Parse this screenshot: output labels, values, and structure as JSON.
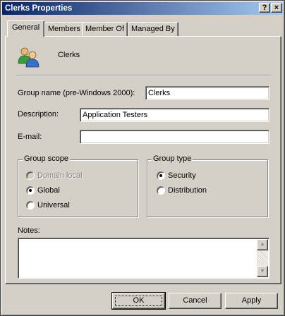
{
  "window": {
    "title": "Clerks Properties",
    "help_button": "?",
    "close_button": "×"
  },
  "tabs": [
    {
      "label": "General",
      "active": true
    },
    {
      "label": "Members",
      "active": false
    },
    {
      "label": "Member Of",
      "active": false
    },
    {
      "label": "Managed By",
      "active": false
    }
  ],
  "header": {
    "icon": "users-group-icon",
    "group_name": "Clerks"
  },
  "fields": {
    "group_name_pre2000": {
      "label": "Group name (pre-Windows 2000):",
      "value": "Clerks"
    },
    "description": {
      "label": "Description:",
      "value": "Application Testers"
    },
    "email": {
      "label": "E-mail:",
      "value": ""
    }
  },
  "group_scope": {
    "title": "Group scope",
    "options": [
      {
        "label": "Domain local",
        "checked": false,
        "enabled": false
      },
      {
        "label": "Global",
        "checked": true,
        "enabled": true
      },
      {
        "label": "Universal",
        "checked": false,
        "enabled": true
      }
    ]
  },
  "group_type": {
    "title": "Group type",
    "options": [
      {
        "label": "Security",
        "checked": true,
        "enabled": true
      },
      {
        "label": "Distribution",
        "checked": false,
        "enabled": true
      }
    ]
  },
  "notes": {
    "label": "Notes:",
    "value": ""
  },
  "buttons": {
    "ok": "OK",
    "cancel": "Cancel",
    "apply": "Apply"
  },
  "colors": {
    "title_gradient_start": "#0a246a",
    "title_gradient_end": "#a6caf0",
    "face": "#d4d0c8"
  }
}
